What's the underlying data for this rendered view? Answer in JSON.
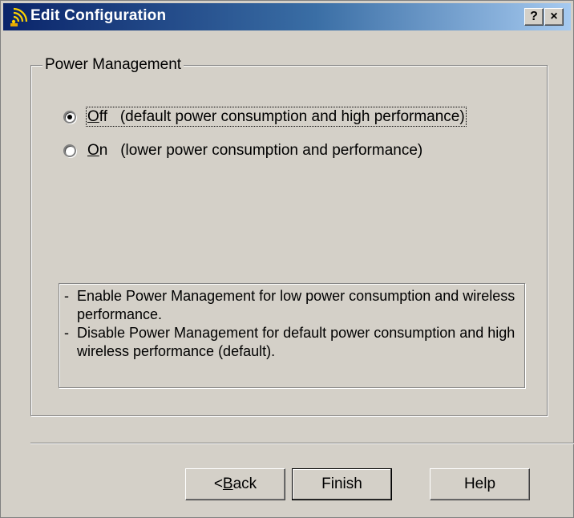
{
  "window": {
    "title": "Edit Configuration",
    "help_glyph": "?",
    "close_glyph": "×"
  },
  "group": {
    "legend": "Power Management"
  },
  "options": [
    {
      "mnemonic": "O",
      "rest": "ff",
      "description": "(default power consumption and high performance)",
      "checked": true
    },
    {
      "mnemonic": "O",
      "rest": "n",
      "description": "(lower power consumption and performance)",
      "checked": false
    }
  ],
  "info": {
    "lines": [
      "Enable Power Management for low power consumption and wireless performance.",
      "Disable Power Management for default power consumption and high wireless performance (default)."
    ]
  },
  "buttons": {
    "back": {
      "prefix": "< ",
      "mnemonic": "B",
      "rest": "ack"
    },
    "finish": "Finish",
    "help": "Help"
  },
  "colors": {
    "title_start": "#0a246a",
    "title_end": "#a6caf0",
    "face": "#d4d0c8"
  },
  "icons": {
    "title": "wireless-signal-icon"
  }
}
